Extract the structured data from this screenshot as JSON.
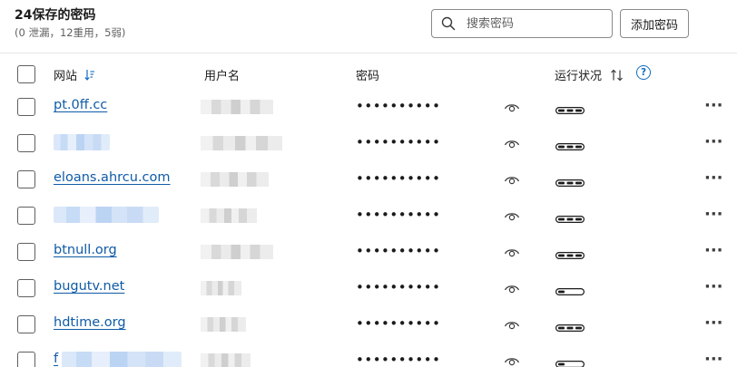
{
  "header": {
    "title": "24保存的密码",
    "subtitle": "(0 泄漏，12重用，5弱)"
  },
  "search": {
    "placeholder": "搜索密码"
  },
  "toolbar": {
    "add_label": "添加密码"
  },
  "columns": {
    "site": "网站",
    "username": "用户名",
    "password": "密码",
    "health": "运行状况",
    "help": "?"
  },
  "colors": {
    "link": "#0f5ba7",
    "accent": "#0f6cbd",
    "border": "#8a8a8a"
  },
  "rows": [
    {
      "site": "pt.0ff.cc",
      "site_hidden": false,
      "password_mask": "••••••••••",
      "health_level": 1.0
    },
    {
      "site": "",
      "site_hidden": true,
      "password_mask": "••••••••••",
      "health_level": 1.0
    },
    {
      "site": "eloans.ahrcu.com",
      "site_hidden": false,
      "password_mask": "••••••••••",
      "health_level": 1.0
    },
    {
      "site": "",
      "site_hidden": true,
      "password_mask": "••••••••••",
      "health_level": 1.0
    },
    {
      "site": "btnull.org",
      "site_hidden": false,
      "password_mask": "••••••••••",
      "health_level": 1.0
    },
    {
      "site": "bugutv.net",
      "site_hidden": false,
      "password_mask": "••••••••••",
      "health_level": 0.33
    },
    {
      "site": "hdtime.org",
      "site_hidden": false,
      "password_mask": "••••••••••",
      "health_level": 1.0
    },
    {
      "site": "f",
      "site_hidden": false,
      "password_mask": "••••••••••",
      "health_level": 0.33
    }
  ],
  "icons": {
    "search": "search-icon",
    "sort": "sort-down-icon",
    "sort_both": "sort-arrows-icon",
    "help": "help-circle-icon",
    "eye": "eye-icon",
    "health": "health-bar-icon",
    "more": "more-icon"
  }
}
